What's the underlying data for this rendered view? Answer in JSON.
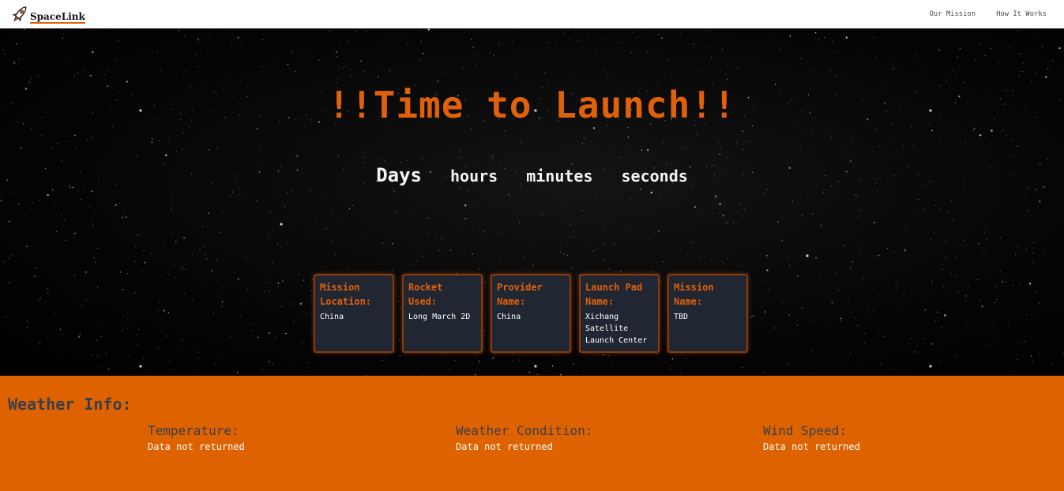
{
  "nav": {
    "brand": "SpaceLink",
    "links": [
      "Our Mission",
      "How It Works"
    ]
  },
  "hero": {
    "title": "!!Time to Launch!!",
    "countdown": [
      "Days",
      "hours",
      "minutes",
      "seconds"
    ]
  },
  "cards": [
    {
      "title": "Mission Location:",
      "value": "China"
    },
    {
      "title": "Rocket Used:",
      "value": "Long March 2D"
    },
    {
      "title": "Provider Name:",
      "value": "China"
    },
    {
      "title": "Launch Pad Name:",
      "value": "Xichang Satellite Launch Center"
    },
    {
      "title": "Mission Name:",
      "value": "TBD"
    }
  ],
  "weather": {
    "heading": "Weather Info:",
    "items": [
      {
        "label": "Temperature:",
        "value": "Data not returned"
      },
      {
        "label": "Weather Condition:",
        "value": "Data not returned"
      },
      {
        "label": "Wind Speed:",
        "value": "Data not returned"
      }
    ]
  },
  "colors": {
    "accent": "#e0610a",
    "weather_bg": "#de6200",
    "card_bg": "#202632",
    "muted_text": "#3a3f4a"
  },
  "icons": {
    "logo": "rocket-icon"
  }
}
